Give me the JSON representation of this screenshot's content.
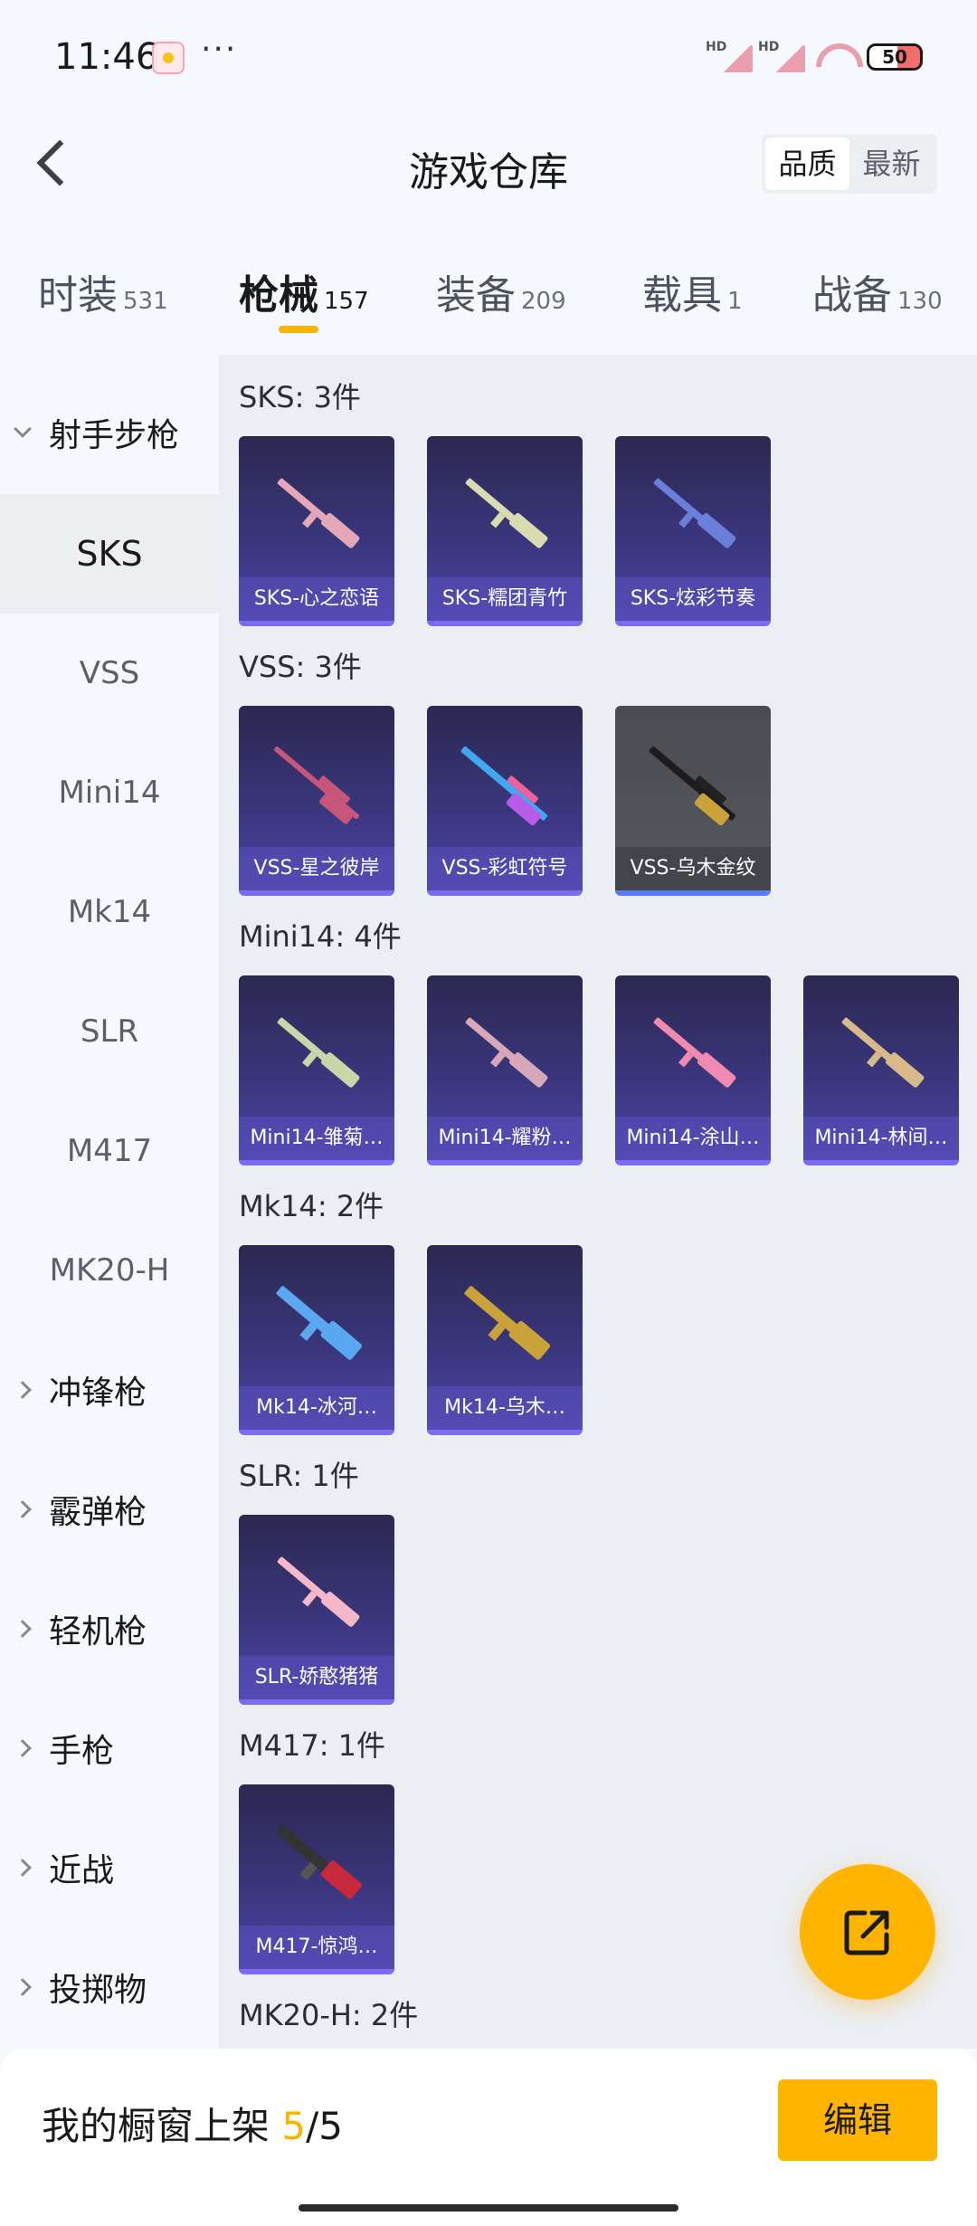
{
  "status_bar": {
    "time": "11:46",
    "dots": "···",
    "hd1": "HD",
    "hd2": "HD",
    "battery": "50"
  },
  "header": {
    "title": "游戏仓库",
    "sort_quality": "品质",
    "sort_latest": "最新"
  },
  "categories": [
    {
      "label": "时装",
      "count": "531"
    },
    {
      "label": "枪械",
      "count": "157"
    },
    {
      "label": "装备",
      "count": "209"
    },
    {
      "label": "载具",
      "count": "1"
    },
    {
      "label": "战备",
      "count": "130"
    }
  ],
  "sidebar": {
    "group_open": "射手步枪",
    "items": [
      "SKS",
      "VSS",
      "Mini14",
      "Mk14",
      "SLR",
      "M417",
      "MK20-H"
    ],
    "groups": [
      "冲锋枪",
      "霰弹枪",
      "轻机枪",
      "手枪",
      "近战",
      "投掷物"
    ]
  },
  "sections": [
    {
      "title": "SKS: 3件",
      "items": [
        "SKS-心之恋语",
        "SKS-糯团青竹",
        "SKS-炫彩节奏"
      ]
    },
    {
      "title": "VSS: 3件",
      "items": [
        "VSS-星之彼岸",
        "VSS-彩虹符号",
        "VSS-乌木金纹"
      ]
    },
    {
      "title": "Mini14: 4件",
      "items": [
        "Mini14-雏菊…",
        "Mini14-耀粉…",
        "Mini14-涂山…",
        "Mini14-林间…"
      ]
    },
    {
      "title": "Mk14: 2件",
      "items": [
        "Mk14-冰河…",
        "Mk14-乌木…"
      ]
    },
    {
      "title": "SLR: 1件",
      "items": [
        "SLR-娇憨猪猪"
      ]
    },
    {
      "title": "M417: 1件",
      "items": [
        "M417-惊鸿…"
      ]
    },
    {
      "title": "MK20-H: 2件"
    }
  ],
  "bottom_bar": {
    "shop_label": "我的橱窗上架 ",
    "shop_count": "5",
    "shop_total": "/5",
    "edit_label": "编辑"
  },
  "colors": {
    "accent": "#ffb400",
    "card_purple": "#3b3780",
    "card_gray": "#55575d"
  },
  "icons": {
    "back": "back-arrow-icon",
    "fab": "share-icon"
  }
}
